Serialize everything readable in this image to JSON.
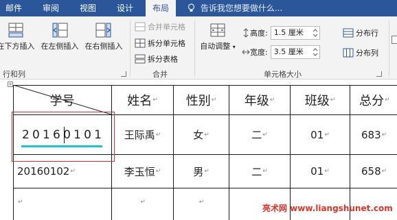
{
  "tabs": [
    "邮件",
    "审阅",
    "视图",
    "设计",
    "布局"
  ],
  "tell_me": "告诉我您想要做什么...",
  "ribbon": {
    "insert_below": "在下方插入",
    "insert_left": "在左侧插入",
    "insert_right": "在右侧插入",
    "rows_cols_group": "行和列",
    "merge_cells": "合并单元格",
    "split_cells": "拆分单元格",
    "split_table": "拆分表格",
    "merge_group": "合并",
    "autofit": "自动调整",
    "height_label": "高度:",
    "height_value": "1.5 厘米",
    "width_label": "宽度:",
    "width_value": "3.5 厘米",
    "distribute_rows": "分布行",
    "distribute_cols": "分布列",
    "cell_size_group": "单元格大小"
  },
  "table": {
    "headers": [
      "学号",
      "姓名",
      "性别",
      "年级",
      "班级",
      "总分"
    ],
    "rows": [
      [
        "20160101",
        "王际禹",
        "女",
        "二",
        "01",
        "683"
      ],
      [
        "20160102",
        "李玉恒",
        "男",
        "二",
        "01",
        "658"
      ]
    ]
  },
  "watermark": "亮术网 www.liangshunet.com",
  "colors": {
    "tabbar": "#2b579a",
    "ribbon": "#f3f3f3",
    "selection": "#e0312e",
    "underline": "#18c6d3"
  }
}
